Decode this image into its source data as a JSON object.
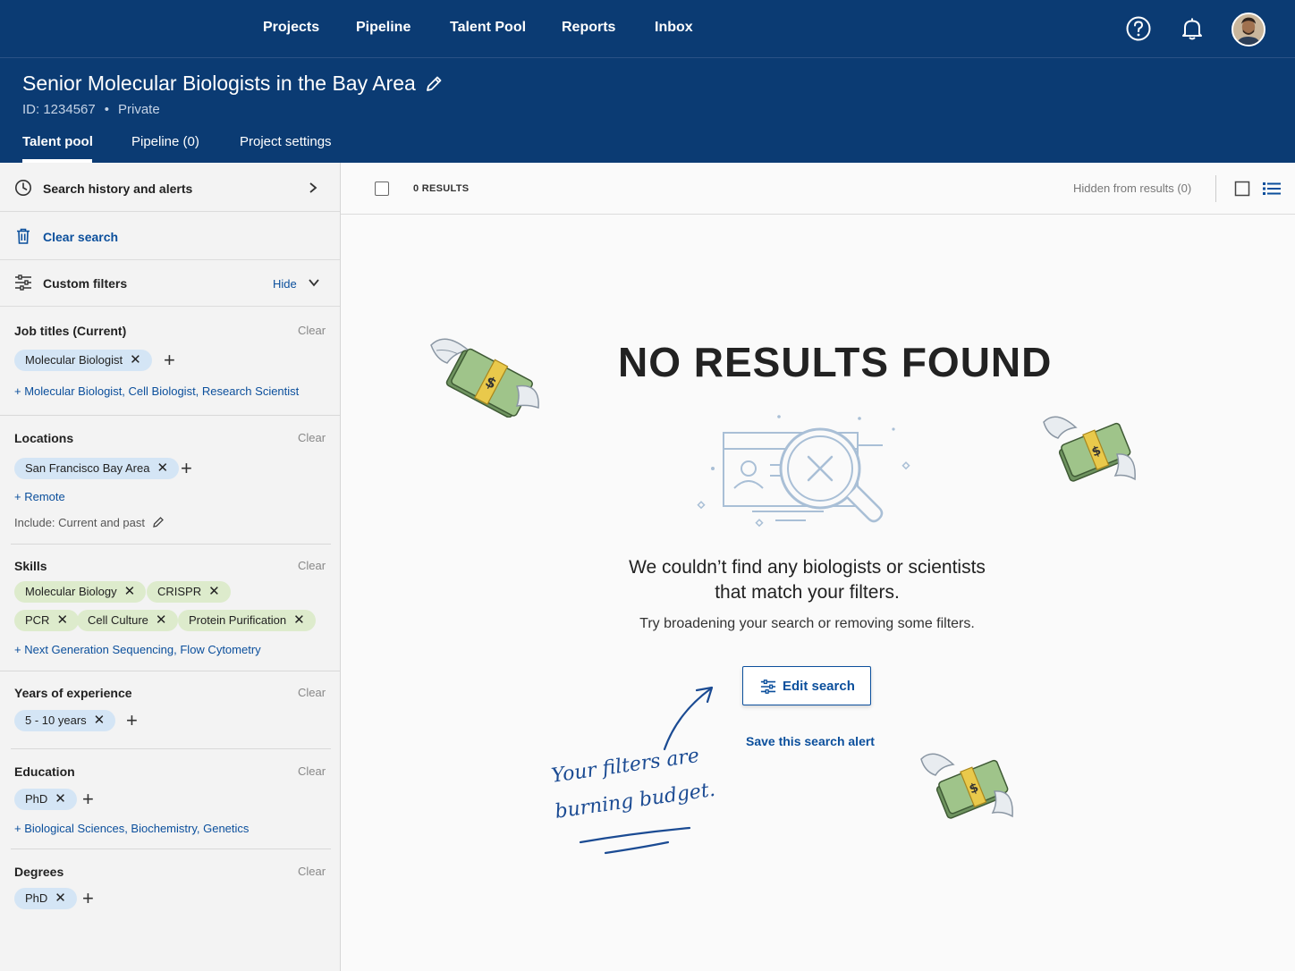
{
  "nav": {
    "items": [
      "Projects",
      "Pipeline",
      "Talent Pool",
      "Reports",
      "Inbox"
    ]
  },
  "project": {
    "title": "Senior Molecular Biologists in the Bay Area",
    "id": "ID: 1234567",
    "visibility": "Private",
    "tabs": [
      "Talent pool",
      "Pipeline (0)",
      "Project settings"
    ]
  },
  "sidebar": {
    "history": "Search history and alerts",
    "clear_search": "Clear search",
    "custom_filters": "Custom filters",
    "hide": "Hide",
    "clear": "Clear",
    "job_titles": {
      "title": "Job titles (Current)",
      "chips": [
        "Molecular Biologist"
      ],
      "suggest": "+ Molecular Biologist, Cell Biologist, Research Scientist"
    },
    "locations": {
      "title": "Locations",
      "chips": [
        "San Francisco Bay Area"
      ],
      "suggest": "+ Remote",
      "include": "Include: Current and past"
    },
    "skills": {
      "title": "Skills",
      "chips": [
        "Molecular Biology",
        "CRISPR",
        "PCR",
        "Cell Culture",
        "Protein Purification"
      ],
      "suggest": "+ Next Generation Sequencing, Flow Cytometry"
    },
    "experience": {
      "title": "Years of experience",
      "chips": [
        "5 - 10 years"
      ]
    },
    "education": {
      "title": "Education",
      "chips": [
        "PhD"
      ],
      "suggest": "+ Biological Sciences, Biochemistry, Genetics"
    },
    "degrees": {
      "title": "Degrees",
      "chips": [
        "PhD"
      ]
    }
  },
  "results": {
    "count": "0 RESULTS",
    "hidden": "Hidden from results (0)"
  },
  "empty": {
    "title": "NO RESULTS FOUND",
    "line1": "We couldn’t find any biologists or scientists",
    "line2": "that match your filters.",
    "hint": "Try broadening your search or removing some filters.",
    "edit_button": "Edit search",
    "save_alert": "Save this search alert",
    "note_line1": "Your filters are",
    "note_line2": "burning budget."
  },
  "icons": {
    "help": "help-circle-icon",
    "bell": "bell-icon",
    "pen": "pencil-icon",
    "history": "clock-icon",
    "trash": "trash-icon",
    "filters": "sliders-icon",
    "money": "money-with-wings-icon"
  },
  "colors": {
    "header": "#0b3b73",
    "link": "#0b4f9c",
    "chip_blue": "#d4e5f5",
    "chip_green": "#ddebcc"
  }
}
